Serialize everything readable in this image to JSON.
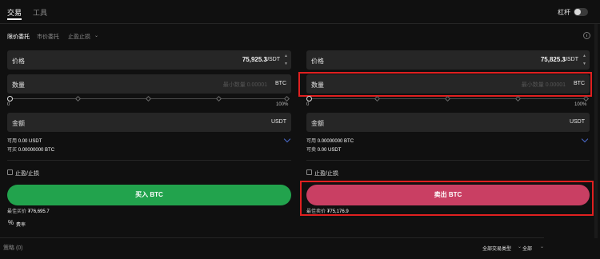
{
  "tabs": {
    "trade": "交易",
    "tools": "工具"
  },
  "leverage_label": "杠杆",
  "order_types": {
    "limit": "限价委托",
    "market": "市价委托",
    "stop": "止盈止损"
  },
  "buy_panel": {
    "price_label": "价格",
    "price_value": "75,925.3",
    "price_unit": "USDT",
    "amount_label": "数量",
    "amount_placeholder": "最小数量 0.00001",
    "amount_unit": "BTC",
    "slider_min": "0",
    "slider_max": "100%",
    "slider_value": 0,
    "total_label": "金额",
    "total_unit": "USDT",
    "avail_label_1": "可用",
    "avail_value_1": "0.00 USDT",
    "avail_label_2": "可买",
    "avail_value_2": "0.00000000 BTC",
    "tpsl_label": "止盈/止损",
    "button_label": "买入 BTC",
    "best_label": "最佳买价",
    "best_value": "₮76,695.7",
    "fee_label": "费率"
  },
  "sell_panel": {
    "price_label": "价格",
    "price_value": "75,825.3",
    "price_unit": "USDT",
    "amount_label": "数量",
    "amount_placeholder": "最小数量 0.00001",
    "amount_unit": "BTC",
    "slider_min": "0",
    "slider_max": "100%",
    "slider_value": 0,
    "total_label": "金额",
    "total_unit": "USDT",
    "avail_label_1": "可用",
    "avail_value_1": "0.00000000 BTC",
    "avail_label_2": "可卖",
    "avail_value_2": "0.00 USDT",
    "tpsl_label": "止盈/止损",
    "button_label": "卖出 BTC",
    "best_label": "最佳卖价",
    "best_value": "₮75,176.9"
  },
  "bottom": {
    "orders_label": "策略 (0)",
    "all_types": "全部交易类型",
    "all": "全部"
  },
  "colors": {
    "buy": "#22a34d",
    "sell": "#c93f63",
    "highlight": "#e02020",
    "background": "#101010",
    "field": "#262626"
  }
}
